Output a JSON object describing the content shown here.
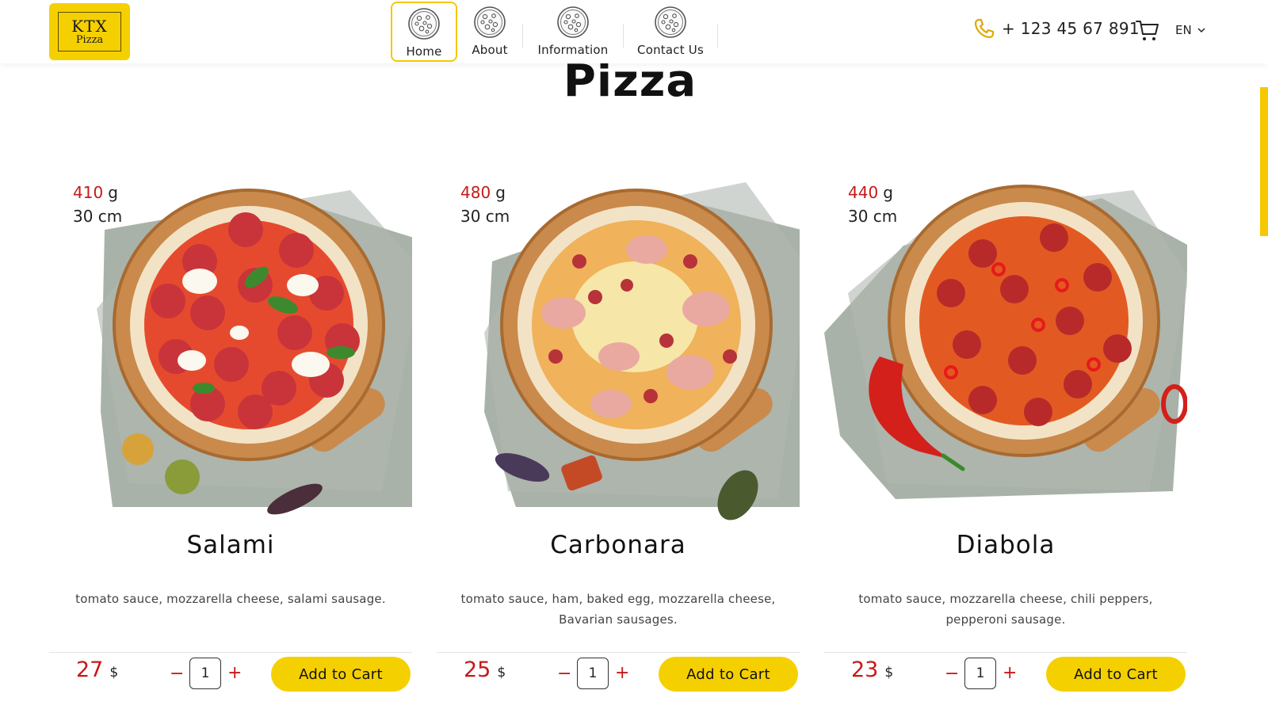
{
  "header": {
    "logo": {
      "line1": "KTX",
      "line2": "Pizza"
    },
    "nav": [
      {
        "label": "Home",
        "active": true
      },
      {
        "label": "About",
        "active": false
      },
      {
        "label": "Information",
        "active": false
      },
      {
        "label": "Contact Us",
        "active": false
      }
    ],
    "phone": "+ 123 45 67 891",
    "language": "EN"
  },
  "page_title": "Pizza",
  "products": [
    {
      "weight": "410",
      "weight_unit": "g",
      "size": "30 cm",
      "name": "Salami",
      "description": "tomato sauce, mozzarella cheese, salami sausage.",
      "price": "27",
      "currency": "$",
      "quantity": "1",
      "button_label": "Add to Cart",
      "minus": "−",
      "plus": "+"
    },
    {
      "weight": "480",
      "weight_unit": "g",
      "size": "30 cm",
      "name": "Carbonara",
      "description": "tomato sauce, ham, baked egg, mozzarella cheese, Bavarian sausages.",
      "price": "25",
      "currency": "$",
      "quantity": "1",
      "button_label": "Add to Cart",
      "minus": "−",
      "plus": "+"
    },
    {
      "weight": "440",
      "weight_unit": "g",
      "size": "30 cm",
      "name": "Diabola",
      "description": "tomato sauce, mozzarella cheese, chili peppers, pepperoni sausage.",
      "price": "23",
      "currency": "$",
      "quantity": "1",
      "button_label": "Add to Cart",
      "minus": "−",
      "plus": "+"
    }
  ],
  "colors": {
    "accent_yellow": "#f5d000",
    "price_red": "#c81818",
    "text_dark": "#111111"
  },
  "icons": {
    "nav": "pizza-icon",
    "phone": "phone-icon",
    "cart": "cart-icon",
    "lang": "chevron-down-icon"
  }
}
